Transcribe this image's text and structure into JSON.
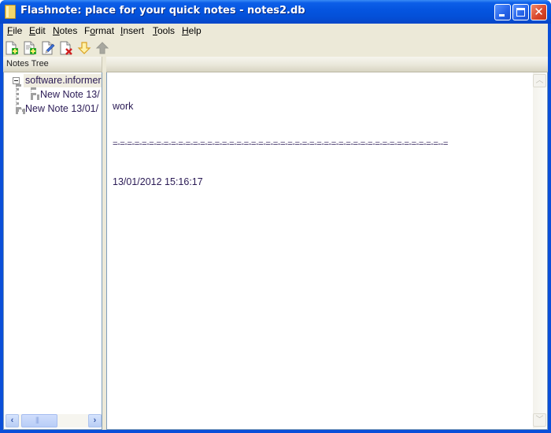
{
  "window": {
    "title": "Flashnote: place for your quick notes - notes2.db",
    "controls": {
      "minimize": "minimize",
      "maximize": "maximize",
      "close": "close"
    }
  },
  "menu": {
    "items": [
      {
        "label": "File",
        "accel": "F",
        "rest": "ile"
      },
      {
        "label": "Edit",
        "accel": "E",
        "rest": "dit"
      },
      {
        "label": "Notes",
        "accel": "N",
        "rest": "otes"
      },
      {
        "label": "Format",
        "pre": "F",
        "accel": "o",
        "rest": "rmat"
      },
      {
        "label": "Insert",
        "accel": "I",
        "rest": "nsert"
      },
      {
        "label": "Tools",
        "accel": "T",
        "rest": "ools"
      },
      {
        "label": "Help",
        "accel": "H",
        "rest": "elp"
      }
    ]
  },
  "toolbar": {
    "buttons": [
      {
        "name": "new-note",
        "icon": "page-plus-icon",
        "enabled": true
      },
      {
        "name": "new-subnote",
        "icon": "page-lines-plus-icon",
        "enabled": true
      },
      {
        "name": "edit-note",
        "icon": "page-pencil-icon",
        "enabled": true
      },
      {
        "name": "delete-note",
        "icon": "page-x-icon",
        "enabled": true
      },
      {
        "name": "move-down",
        "icon": "arrow-down-icon",
        "enabled": true
      },
      {
        "name": "move-up",
        "icon": "arrow-up-icon",
        "enabled": false
      }
    ]
  },
  "tree": {
    "header": "Notes Tree",
    "nodes": [
      {
        "label": "software.informer",
        "level": 0,
        "expanded": true,
        "selected": true
      },
      {
        "label": "New Note 13/",
        "level": 1
      },
      {
        "label": "New Note 13/01/",
        "level": 0
      }
    ]
  },
  "editor": {
    "lines": [
      "work",
      "=-=-=-=-=-=-=-=-=-=-=-=-=-=-=-=-=-=-=-=-=-=-=-=-=-=-=-=-=-=-=-=-=-=-=-=-=-=-=-=-=-=-=-=-=--=",
      "13/01/2012 15:16:17"
    ]
  },
  "colors": {
    "titlebar": "#0555e0",
    "chrome": "#ece9d8",
    "text": "#2a1a55"
  }
}
